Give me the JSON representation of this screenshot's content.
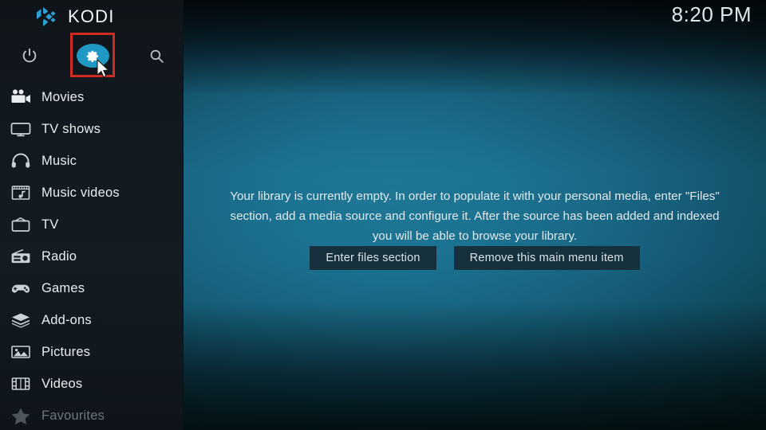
{
  "app": {
    "name": "KODI",
    "logo_icon": "kodi-logo-icon",
    "accent_color": "#1f99c4",
    "highlight_color": "#cf2b23",
    "sidebar_color": "#131a21"
  },
  "header": {
    "clock": "8:20 PM",
    "top_icons": [
      {
        "name": "power-icon",
        "label": "Power"
      },
      {
        "name": "gear-icon",
        "label": "Settings",
        "selected": true
      },
      {
        "name": "search-icon",
        "label": "Search"
      }
    ]
  },
  "sidebar": {
    "items": [
      {
        "label": "Movies",
        "icon": "movie-camera-icon"
      },
      {
        "label": "TV shows",
        "icon": "television-icon"
      },
      {
        "label": "Music",
        "icon": "headphones-icon"
      },
      {
        "label": "Music videos",
        "icon": "music-video-icon"
      },
      {
        "label": "TV",
        "icon": "retro-tv-icon"
      },
      {
        "label": "Radio",
        "icon": "radio-icon"
      },
      {
        "label": "Games",
        "icon": "gamepad-icon"
      },
      {
        "label": "Add-ons",
        "icon": "addon-box-icon"
      },
      {
        "label": "Pictures",
        "icon": "picture-icon"
      },
      {
        "label": "Videos",
        "icon": "film-strip-icon"
      },
      {
        "label": "Favourites",
        "icon": "star-icon"
      }
    ]
  },
  "content": {
    "empty_message": "Your library is currently empty. In order to populate it with your personal media, enter \"Files\" section, add a media source and configure it. After the source has been added and indexed you will be able to browse your library.",
    "buttons": [
      {
        "label": "Enter files section"
      },
      {
        "label": "Remove this main menu item"
      }
    ]
  }
}
